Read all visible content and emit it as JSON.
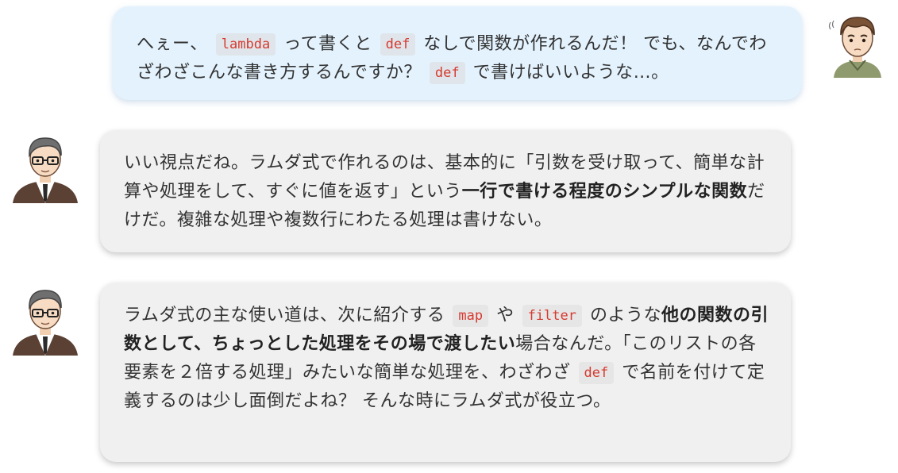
{
  "chat": {
    "message1": {
      "p1": "へぇー、",
      "code1": "lambda",
      "p2": "って書くと",
      "code2": "def",
      "p3": "なしで関数が作れるんだ！ でも、なんでわざわざこんな書き方するんですか？",
      "code3": "def",
      "p4": "で書けばいいような…。"
    },
    "message2": {
      "p1": "いい視点だね。ラムダ式で作れるのは、基本的に「引数を受け取って、簡単な計算や処理をして、すぐに値を返す」という",
      "b1": "一行で書ける程度のシンプルな関数",
      "p2": "だけだ。複雑な処理や複数行にわたる処理は書けない。"
    },
    "message3": {
      "p1": "ラムダ式の主な使い道は、次に紹介する",
      "code1": "map",
      "p2": "や",
      "code2": "filter",
      "p3": "のような",
      "b1": "他の関数の引数として、ちょっとした処理をその場で渡したい",
      "p4": "場合なんだ。「このリストの各要素を２倍する処理」みたいな簡単な処理を、わざわざ",
      "code3": "def",
      "p5": "で名前を付けて定義するのは少し面倒だよね？ そんな時にラムダ式が役立つ。"
    }
  },
  "colors": {
    "user_bubble": "#e3f2fd",
    "mentor_bubble": "#f0f0f0",
    "code_text": "#d63a2f",
    "body_text": "#333333"
  },
  "icons": {
    "student_avatar": "student-avatar-icon",
    "mentor_avatar": "mentor-avatar-icon"
  }
}
